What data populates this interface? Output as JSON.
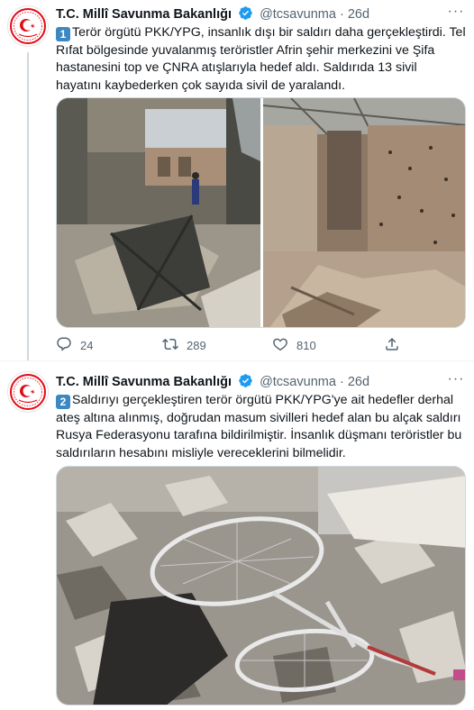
{
  "tweets": [
    {
      "author": "T.C. Millî Savunma Bakanlığı",
      "handle": "@tcsavunma",
      "separator": "·",
      "time": "26d",
      "keycap": "1",
      "text": "Terör örgütü PKK/YPG, insanlık dışı bir saldırı daha gerçekleştirdi. Tel Rıfat bölgesinde yuvalanmış teröristler Afrin şehir merkezini ve Şifa hastanesini top ve ÇNRA atışlarıyla hedef aldı. Saldırıda 13 sivil hayatını kaybederken çok sayıda sivil de yaralandı.",
      "replies": "24",
      "retweets": "289",
      "likes": "810"
    },
    {
      "author": "T.C. Millî Savunma Bakanlığı",
      "handle": "@tcsavunma",
      "separator": "·",
      "time": "26d",
      "keycap": "2",
      "text": "Saldırıyı gerçekleştiren terör örgütü PKK/YPG'ye ait hedefler derhal ateş altına alınmış, doğrudan masum sivilleri hedef alan bu alçak saldırı Rusya Federasyonu tarafına bildirilmiştir. İnsanlık düşmanı teröristler bu saldırıların hesabını misliyle vereceklerini bilmelidir."
    }
  ],
  "colors": {
    "accent": "#1d9bf0",
    "keycap": "#3b88c3",
    "logo_red": "#e30a17",
    "secondary_text": "#536471"
  },
  "icons": [
    "ministry-logo-icon",
    "verified-badge-icon",
    "more-icon",
    "reply-icon",
    "retweet-icon",
    "like-icon",
    "share-icon"
  ]
}
